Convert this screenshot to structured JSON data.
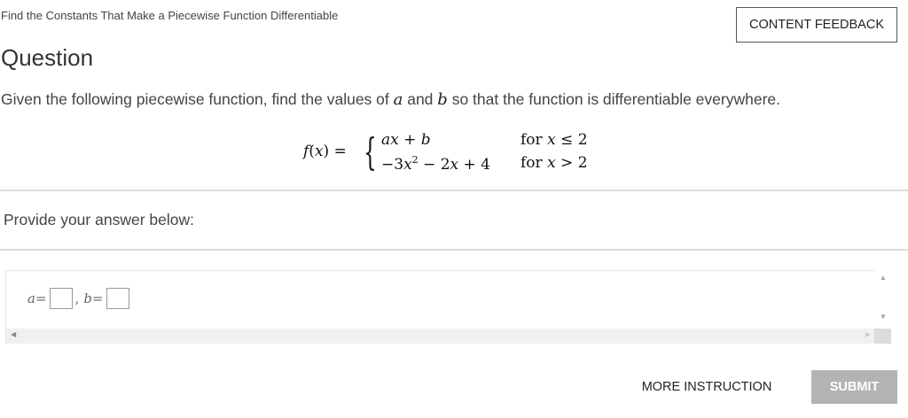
{
  "header": {
    "breadcrumb": "Find the Constants That Make a Piecewise Function Differentiable",
    "feedback_label": "CONTENT FEEDBACK"
  },
  "question": {
    "title": "Question",
    "prompt_before": "Given the following piecewise function, find the values of ",
    "var_a": "a",
    "prompt_and": " and ",
    "var_b": "b",
    "prompt_after": " so that the function is differentiable everywhere."
  },
  "equation": {
    "lhs_f": "f",
    "lhs_open": "(",
    "lhs_x": "x",
    "lhs_close": ")",
    "equals": " = ",
    "brace": "{",
    "case1_expr_a": "ax",
    "case1_expr_rest": " + b",
    "case2_expr_pre": "−3",
    "case2_expr_x": "x",
    "case2_expr_pow": "2",
    "case2_expr_mid": " − 2",
    "case2_expr_x2": "x",
    "case2_expr_end": " + 4",
    "case1_cond_for": "for ",
    "case1_cond_x": "x",
    "case1_cond_rel": " ≤ 2",
    "case2_cond_for": "for ",
    "case2_cond_x": "x",
    "case2_cond_rel": " > 2"
  },
  "answer": {
    "label": "Provide your answer below:",
    "a_var": "a",
    "a_eq": " = ",
    "sep": ",",
    "b_var": "b",
    "b_eq": " = "
  },
  "scroll": {
    "up_glyph": "▲",
    "down_glyph": "▼",
    "left_glyph": "◀",
    "right_glyph": "▶"
  },
  "footer": {
    "more_label": "MORE INSTRUCTION",
    "submit_label": "SUBMIT"
  },
  "colors": {
    "submit_bg": "#b3b3b3",
    "divider": "#dcdcdc",
    "text": "#333333"
  }
}
